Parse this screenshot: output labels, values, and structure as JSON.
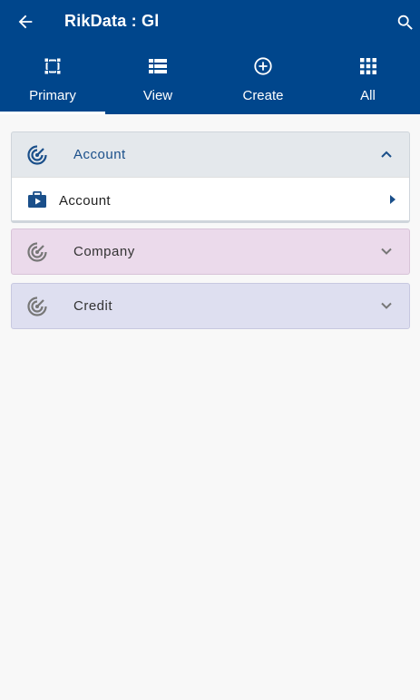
{
  "header": {
    "title": "RikData : Gl"
  },
  "tabs": [
    {
      "label": "Primary",
      "icon": "crop-frame-icon",
      "active": true
    },
    {
      "label": "View",
      "icon": "list-view-icon",
      "active": false
    },
    {
      "label": "Create",
      "icon": "add-circle-icon",
      "active": false
    },
    {
      "label": "All",
      "icon": "grid-apps-icon",
      "active": false
    }
  ],
  "sections": [
    {
      "label": "Account",
      "icon": "radar-icon",
      "expanded": true,
      "color": "#e4e8ec",
      "items": [
        {
          "label": "Account",
          "icon": "briefcase-play-icon"
        }
      ]
    },
    {
      "label": "Company",
      "icon": "radar-icon",
      "expanded": false,
      "color": "#ebdaeb"
    },
    {
      "label": "Credit",
      "icon": "radar-icon",
      "expanded": false,
      "color": "#dedff0"
    }
  ],
  "colors": {
    "appbar": "#00468c",
    "accent": "#1a4f8a",
    "background": "#f8f8f8"
  }
}
